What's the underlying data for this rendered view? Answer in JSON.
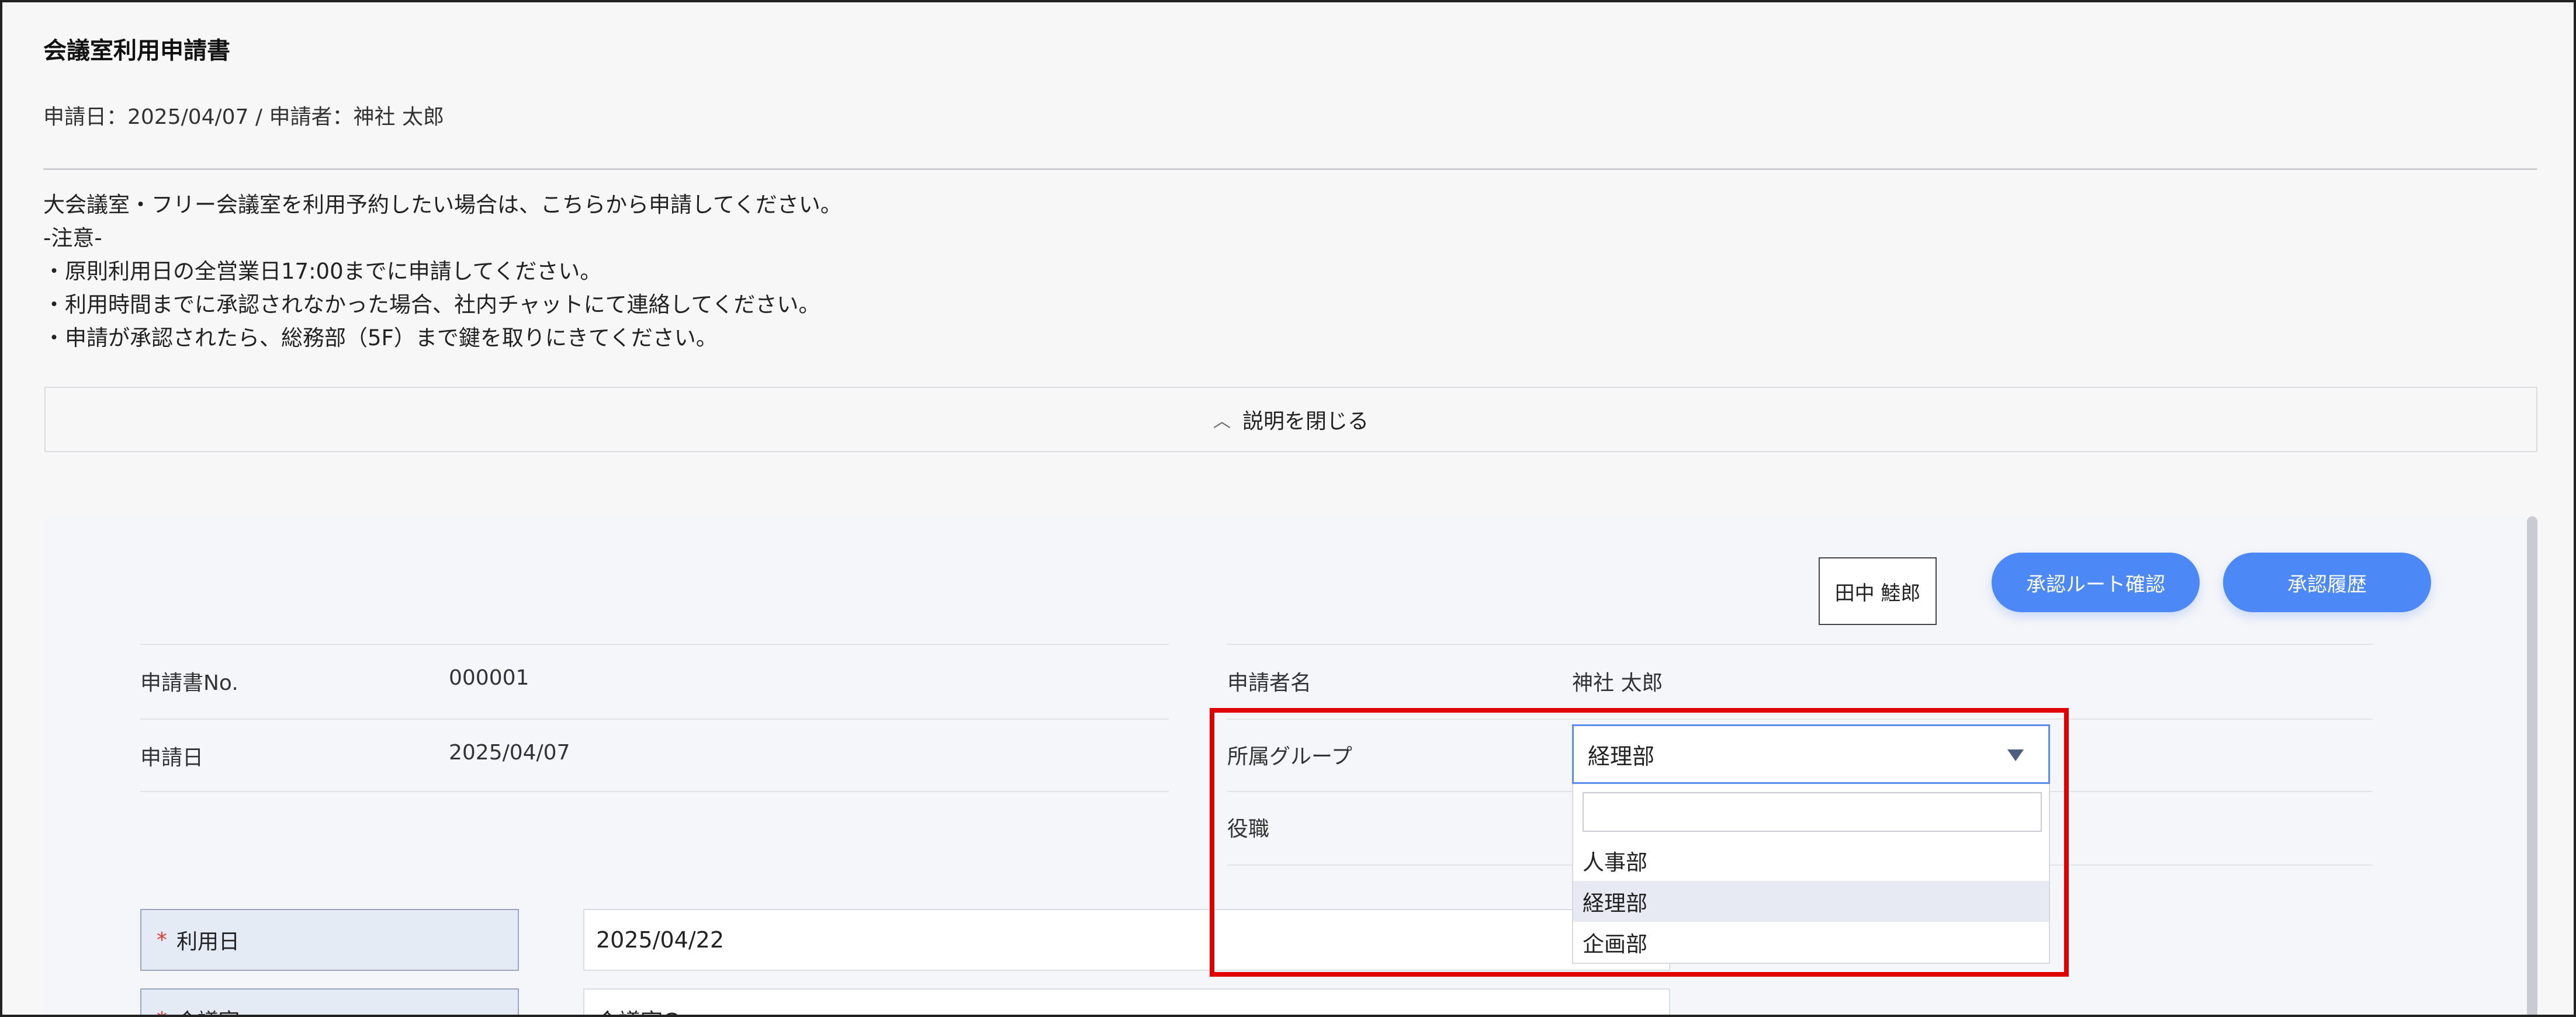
{
  "header": {
    "title": "会議室利用申請書",
    "meta": "申請日：2025/04/07 / 申請者：神社 太郎"
  },
  "description": {
    "lines": [
      "大会議室・フリー会議室を利用予約したい場合は、こちらから申請してください。",
      "-注意-",
      "・原則利用日の全営業日17:00までに申請してください。",
      "・利用時間までに承認されなかった場合、社内チャットにて連絡してください。",
      "・申請が承認されたら、総務部（5F）まで鍵を取りにきてください。"
    ],
    "toggle_label": "説明を閉じる"
  },
  "toolbar": {
    "approver_name": "田中 鯥郎",
    "route_button": "承認ルート確認",
    "history_button": "承認履歴"
  },
  "form_info": {
    "doc_no_label": "申請書No.",
    "doc_no_value": "000001",
    "date_label": "申請日",
    "date_value": "2025/04/07",
    "applicant_label": "申請者名",
    "applicant_value": "神社 太郎",
    "group_label": "所属グループ",
    "position_label": "役職"
  },
  "group_select": {
    "selected": "経理部",
    "search_value": "",
    "options": [
      "人事部",
      "経理部",
      "企画部"
    ]
  },
  "fields": {
    "use_date_label": "利用日",
    "use_date_value": "2025/04/22",
    "room_label": "会議室",
    "room_value": "会議室C",
    "required_mark": "*"
  },
  "colors": {
    "accent": "#4d88f7",
    "highlight": "#e00000",
    "required": "#e53935"
  }
}
